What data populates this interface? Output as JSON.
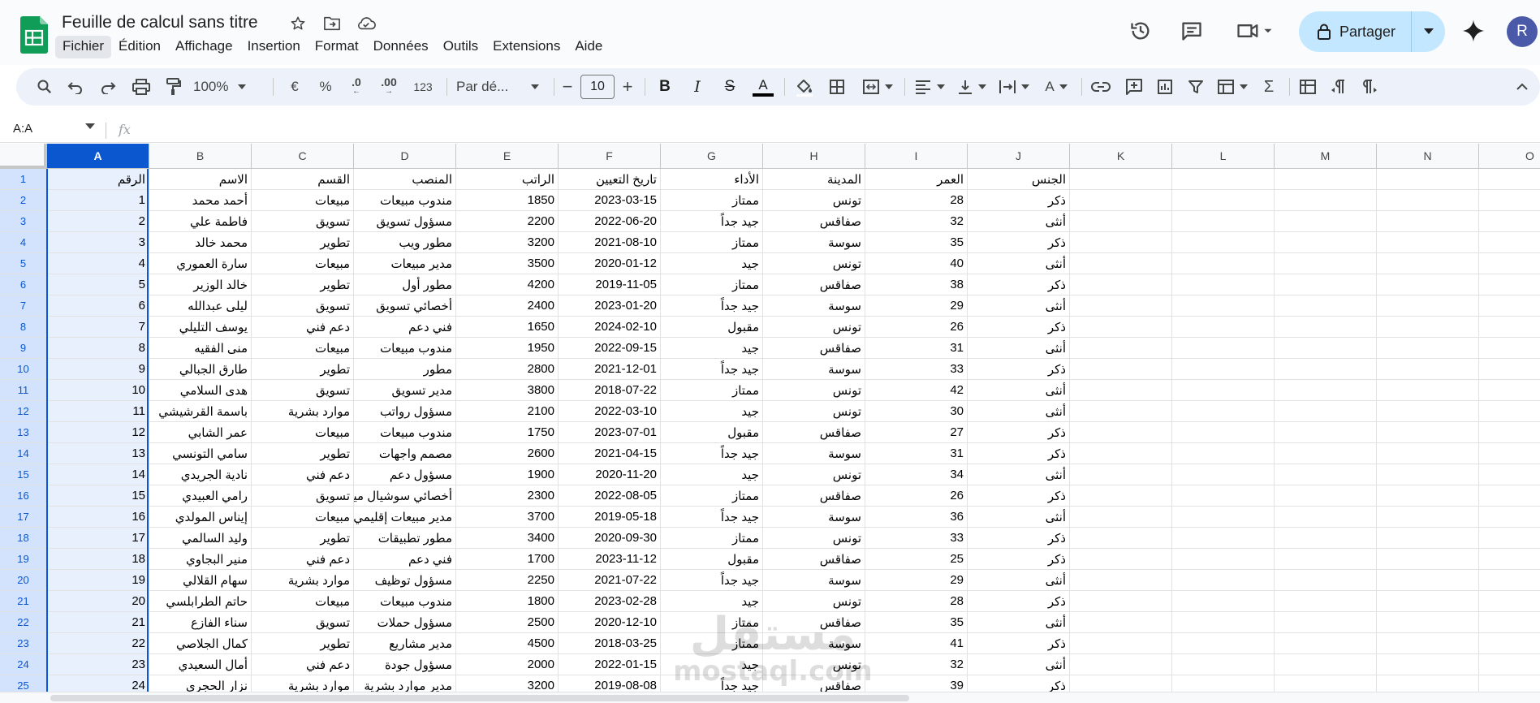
{
  "document": {
    "title": "Feuille de calcul sans titre"
  },
  "menu": [
    "Fichier",
    "Édition",
    "Affichage",
    "Insertion",
    "Format",
    "Données",
    "Outils",
    "Extensions",
    "Aide"
  ],
  "header": {
    "share_label": "Partager",
    "avatar_letter": "R"
  },
  "toolbar": {
    "zoom": "100%",
    "currency": "€",
    "percent": "%",
    "dec_decrease": ".0",
    "dec_increase": ".00",
    "number_format": "123",
    "font": "Par dé...",
    "font_size": "10"
  },
  "formula_bar": {
    "name_box": "A:A",
    "fx": "fx"
  },
  "grid": {
    "selected_column": "A",
    "columns": [
      "A",
      "B",
      "C",
      "D",
      "E",
      "F",
      "G",
      "H",
      "I",
      "J",
      "K",
      "L",
      "M",
      "N",
      "O"
    ],
    "row_numbers": [
      "1",
      "2",
      "3",
      "4",
      "5",
      "6",
      "7",
      "8",
      "9",
      "10",
      "11",
      "12",
      "13",
      "14",
      "15",
      "16",
      "17",
      "18",
      "19",
      "20",
      "21",
      "22",
      "23",
      "24",
      "25"
    ],
    "rows": [
      [
        "الرقم",
        "الاسم",
        "القسم",
        "المنصب",
        "الراتب",
        "تاريخ التعيين",
        "الأداء",
        "المدينة",
        "العمر",
        "الجنس"
      ],
      [
        "1",
        "أحمد محمد",
        "مبيعات",
        "مندوب مبيعات",
        "1850",
        "2023-03-15",
        "ممتاز",
        "تونس",
        "28",
        "ذكر"
      ],
      [
        "2",
        "فاطمة علي",
        "تسويق",
        "مسؤول تسويق",
        "2200",
        "2022-06-20",
        "جيد جداً",
        "صفاقس",
        "32",
        "أنثى"
      ],
      [
        "3",
        "محمد خالد",
        "تطوير",
        "مطور ويب",
        "3200",
        "2021-08-10",
        "ممتاز",
        "سوسة",
        "35",
        "ذكر"
      ],
      [
        "4",
        "سارة العموري",
        "مبيعات",
        "مدير مبيعات",
        "3500",
        "2020-01-12",
        "جيد",
        "تونس",
        "40",
        "أنثى"
      ],
      [
        "5",
        "خالد الوزير",
        "تطوير",
        "مطور أول",
        "4200",
        "2019-11-05",
        "ممتاز",
        "صفاقس",
        "38",
        "ذكر"
      ],
      [
        "6",
        "ليلى عبدالله",
        "تسويق",
        "أخصائي تسويق",
        "2400",
        "2023-01-20",
        "جيد جداً",
        "سوسة",
        "29",
        "أنثى"
      ],
      [
        "7",
        "يوسف التليلي",
        "دعم فني",
        "فني دعم",
        "1650",
        "2024-02-10",
        "مقبول",
        "تونس",
        "26",
        "ذكر"
      ],
      [
        "8",
        "منى الفقيه",
        "مبيعات",
        "مندوب مبيعات",
        "1950",
        "2022-09-15",
        "جيد",
        "صفاقس",
        "31",
        "أنثى"
      ],
      [
        "9",
        "طارق الجبالي",
        "تطوير",
        "مطور",
        "2800",
        "2021-12-01",
        "جيد جداً",
        "سوسة",
        "33",
        "ذكر"
      ],
      [
        "10",
        "هدى السلامي",
        "تسويق",
        "مدير تسويق",
        "3800",
        "2018-07-22",
        "ممتاز",
        "تونس",
        "42",
        "أنثى"
      ],
      [
        "11",
        "باسمة القرشيشي",
        "موارد بشرية",
        "مسؤول رواتب",
        "2100",
        "2022-03-10",
        "جيد",
        "تونس",
        "30",
        "أنثى"
      ],
      [
        "12",
        "عمر الشابي",
        "مبيعات",
        "مندوب مبيعات",
        "1750",
        "2023-07-01",
        "مقبول",
        "صفاقس",
        "27",
        "ذكر"
      ],
      [
        "13",
        "سامي التونسي",
        "تطوير",
        "مصمم واجهات",
        "2600",
        "2021-04-15",
        "جيد جداً",
        "سوسة",
        "31",
        "ذكر"
      ],
      [
        "14",
        "نادية الجريدي",
        "دعم فني",
        "مسؤول دعم",
        "1900",
        "2020-11-20",
        "جيد",
        "تونس",
        "34",
        "أنثى"
      ],
      [
        "15",
        "رامي العبيدي",
        "تسويق",
        "أخصائي سوشيال ميديا",
        "2300",
        "2022-08-05",
        "ممتاز",
        "صفاقس",
        "26",
        "ذكر"
      ],
      [
        "16",
        "إيناس المولدي",
        "مبيعات",
        "مدير مبيعات إقليمي",
        "3700",
        "2019-05-18",
        "جيد جداً",
        "سوسة",
        "36",
        "أنثى"
      ],
      [
        "17",
        "وليد السالمي",
        "تطوير",
        "مطور تطبيقات",
        "3400",
        "2020-09-30",
        "ممتاز",
        "تونس",
        "33",
        "ذكر"
      ],
      [
        "18",
        "منير البجاوي",
        "دعم فني",
        "فني دعم",
        "1700",
        "2023-11-12",
        "مقبول",
        "صفاقس",
        "25",
        "ذكر"
      ],
      [
        "19",
        "سهام القلالي",
        "موارد بشرية",
        "مسؤول توظيف",
        "2250",
        "2021-07-22",
        "جيد جداً",
        "سوسة",
        "29",
        "أنثى"
      ],
      [
        "20",
        "حاتم الطرابلسي",
        "مبيعات",
        "مندوب مبيعات",
        "1800",
        "2023-02-28",
        "جيد",
        "تونس",
        "28",
        "ذكر"
      ],
      [
        "21",
        "سناء الفازع",
        "تسويق",
        "مسؤول حملات",
        "2500",
        "2020-12-10",
        "ممتاز",
        "صفاقس",
        "35",
        "أنثى"
      ],
      [
        "22",
        "كمال الجلاصي",
        "تطوير",
        "مدير مشاريع",
        "4500",
        "2018-03-25",
        "ممتاز",
        "سوسة",
        "41",
        "ذكر"
      ],
      [
        "23",
        "أمال السعيدي",
        "دعم فني",
        "مسؤول جودة",
        "2000",
        "2022-01-15",
        "جيد",
        "تونس",
        "32",
        "أنثى"
      ],
      [
        "24",
        "نزار الحجري",
        "موارد بشرية",
        "مدير موارد بشرية",
        "3200",
        "2019-08-08",
        "جيد جداً",
        "صفاقس",
        "39",
        "ذكر"
      ]
    ]
  },
  "watermark": {
    "arabic": "مستقل",
    "latin": "mostaql.com"
  },
  "colors": {
    "accent": "#0b57d0",
    "share_bg": "#c2e7ff",
    "toolbar_bg": "#edf2fa",
    "sheets_green": "#0f9d58",
    "avatar_bg": "#4a5aa8"
  }
}
